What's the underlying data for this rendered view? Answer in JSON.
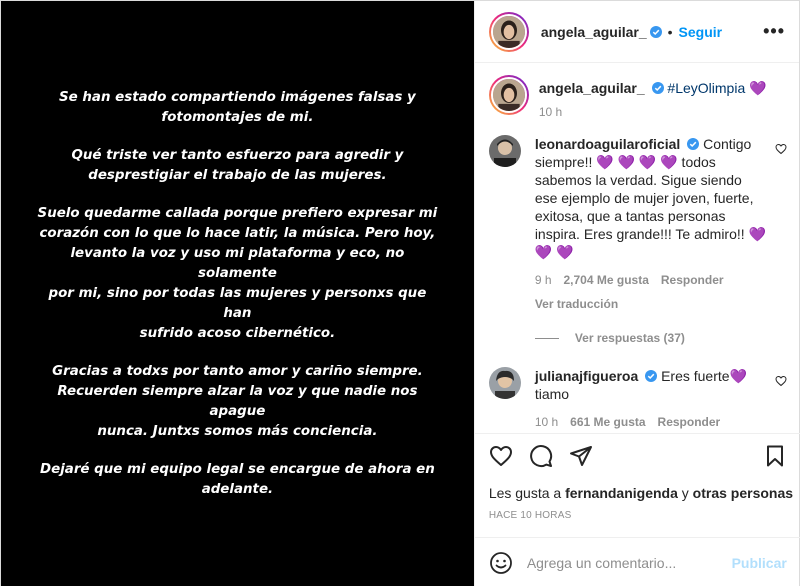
{
  "media": {
    "paragraphs": [
      "Se han estado compartiendo imágenes falsas y\nfotomontajes de mi.",
      "Qué triste ver tanto esfuerzo para agredir y\ndesprestigiar el trabajo de las mujeres.",
      "Suelo quedarme callada porque prefiero expresar mi\ncorazón con lo que lo hace latir, la música. Pero hoy,\nlevanto la voz y uso mi plataforma y eco, no solamente\npor mi, sino por todas las mujeres y personxs que han\nsufrido acoso cibernético.",
      "Gracias a todxs por tanto amor y cariño siempre.\nRecuerden siempre alzar la voz y que nadie nos apague\nnunca. Juntxs somos más conciencia.",
      "Dejaré que mi equipo legal se encargue de ahora en\nadelante."
    ]
  },
  "header": {
    "username": "angela_aguilar_",
    "separator": "•",
    "follow_label": "Seguir",
    "more_label": "•••"
  },
  "caption": {
    "username": "angela_aguilar_",
    "hashtag": "#LeyOlimpia",
    "emoji": "💜",
    "time": "10 h"
  },
  "comments": [
    {
      "username": "leonardoaguilaroficial",
      "text": "Contigo siempre!! 💜 💜 💜 💜 todos sabemos la verdad. Sigue siendo ese ejemplo de mujer joven, fuerte, exitosa, que a tantas personas inspira. Eres grande!!! Te admiro!! 💜 💜 💜",
      "time": "9 h",
      "likes": "2,704 Me gusta",
      "reply": "Responder",
      "translate": "Ver traducción",
      "view_replies": "Ver respuestas (37)"
    },
    {
      "username": "julianajfigueroa",
      "text": "Eres fuerte💜 tiamo",
      "time": "10 h",
      "likes": "661 Me gusta",
      "reply": "Responder"
    }
  ],
  "likes": {
    "prefix": "Les gusta a",
    "user": "fernandanigenda",
    "conjunction": "y",
    "others": "otras personas"
  },
  "timestamp": "HACE 10 HORAS",
  "add_comment": {
    "placeholder": "Agrega un comentario...",
    "publish_label": "Publicar"
  },
  "colors": {
    "link": "#0095f6",
    "verified": "#3897f0",
    "heart_emoji": "#8a3ffc",
    "muted": "#8e8e8e"
  },
  "icons": {
    "verified": "verified-badge-icon",
    "like": "heart-icon",
    "comment": "comment-bubble-icon",
    "share": "paper-plane-icon",
    "save": "bookmark-icon",
    "emoji": "smiley-icon"
  }
}
